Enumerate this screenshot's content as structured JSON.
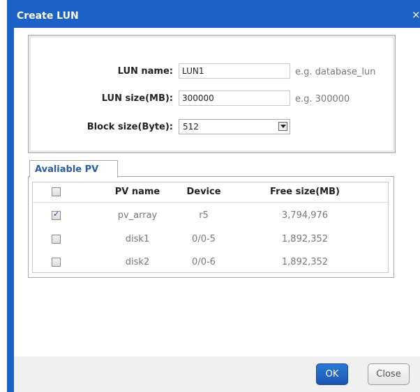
{
  "dialog": {
    "title": "Create LUN",
    "close_glyph": "×"
  },
  "form": {
    "lun_name": {
      "label": "LUN name:",
      "value": "LUN1",
      "hint": "e.g. database_lun"
    },
    "lun_size": {
      "label": "LUN size(MB):",
      "value": "300000",
      "hint": "e.g. 300000"
    },
    "block_size": {
      "label": "Block size(Byte):",
      "value": "512"
    }
  },
  "tab": {
    "label": "Avaliable PV"
  },
  "pv_table": {
    "headers": {
      "name": "PV name",
      "device": "Device",
      "free": "Free size(MB)"
    },
    "rows": [
      {
        "name": "pv_array",
        "device": "r5",
        "free": "3,794,976",
        "checked": true
      },
      {
        "name": "disk1",
        "device": "0/0-5",
        "free": "1,892,352",
        "checked": false
      },
      {
        "name": "disk2",
        "device": "0/0-6",
        "free": "1,892,352",
        "checked": false
      }
    ]
  },
  "buttons": {
    "ok": "OK",
    "close": "Close"
  },
  "colors": {
    "title_bar": "#1c62c6",
    "tab_text": "#2a5d9f",
    "ok_button": "#1a55b0"
  }
}
